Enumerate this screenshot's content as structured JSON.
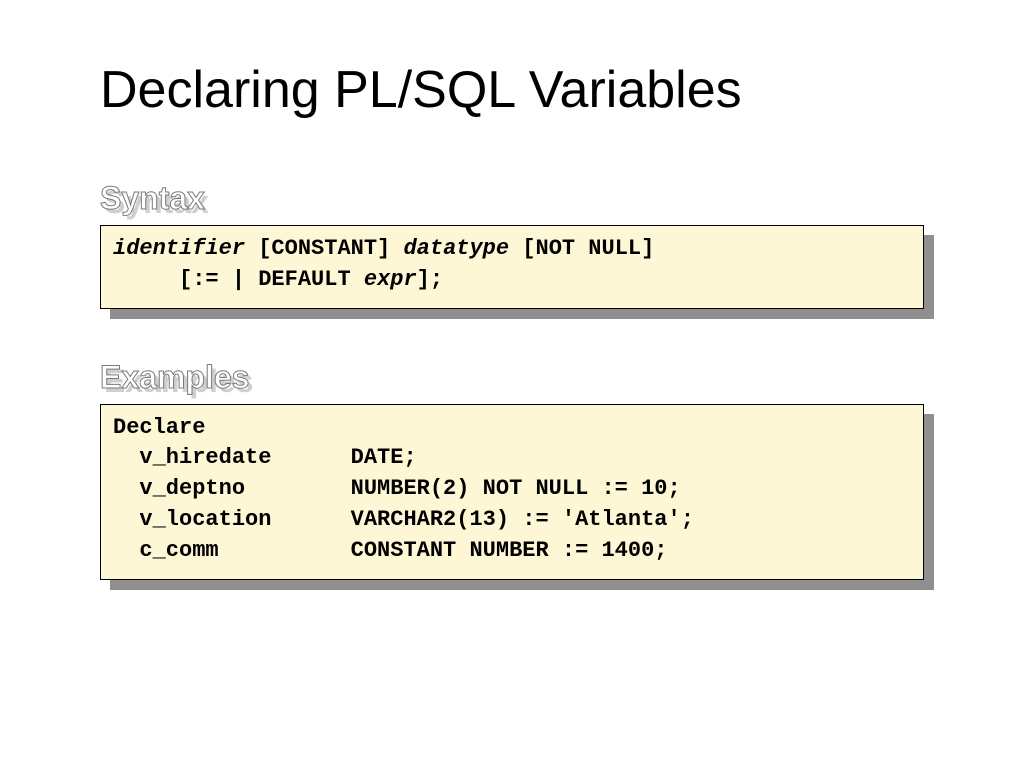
{
  "title": "Declaring PL/SQL Variables",
  "sections": {
    "syntax": {
      "label": "Syntax",
      "tokens": {
        "identifier": "identifier",
        "constant": " [CONSTANT] ",
        "datatype": "datatype",
        "notnull_line": " [NOT NULL]  ",
        "indent": "     ",
        "assign": "[:= | DEFAULT ",
        "expr": "expr",
        "end": "];"
      }
    },
    "examples": {
      "label": "Examples",
      "lines": {
        "l0": "Declare",
        "l1": "  v_hiredate      DATE;",
        "l2": "  v_deptno        NUMBER(2) NOT NULL := 10;",
        "l3": "  v_location      VARCHAR2(13) := 'Atlanta';",
        "l4": "  c_comm          CONSTANT NUMBER := 1400;\t\t\t"
      }
    }
  }
}
